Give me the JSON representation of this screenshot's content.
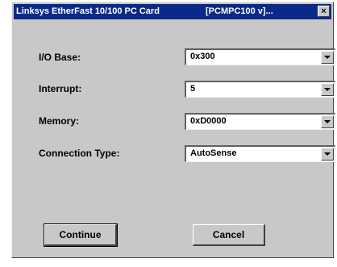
{
  "window": {
    "title": "Linksys EtherFast 10/100 PC Card",
    "title_suffix": "[PCMPC100 v]...",
    "close_glyph": "×",
    "titlebar_color": "#0a2a8a"
  },
  "fields": [
    {
      "label": "I/O Base:",
      "value": "0x300"
    },
    {
      "label": "Interrupt:",
      "value": "5"
    },
    {
      "label": "Memory:",
      "value": "0xD0000"
    },
    {
      "label": "Connection Type:",
      "value": "AutoSense"
    }
  ],
  "buttons": {
    "continue_label": "Continue",
    "cancel_label": "Cancel"
  }
}
